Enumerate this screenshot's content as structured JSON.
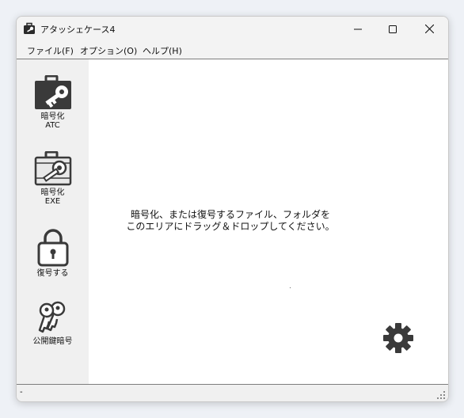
{
  "window": {
    "title": "アタッシェケース4",
    "minimize_icon": "minimize-icon",
    "maximize_icon": "maximize-icon",
    "close_icon": "close-icon"
  },
  "menu": {
    "items": [
      {
        "label": "ファイル(F)"
      },
      {
        "label": "オプション(O)"
      },
      {
        "label": "ヘルプ(H)"
      }
    ]
  },
  "sidebar": {
    "items": [
      {
        "line1": "暗号化",
        "line2": "ATC",
        "icon": "briefcase-key-icon"
      },
      {
        "line1": "暗号化",
        "line2": "EXE",
        "icon": "briefcase-key-outline-icon"
      },
      {
        "line1": "復号する",
        "line2": "",
        "icon": "padlock-icon"
      },
      {
        "line1": "公開鍵暗号",
        "line2": "",
        "icon": "keys-icon"
      }
    ]
  },
  "drop_area": {
    "line1": "暗号化、または復号するファイル、フォルダを",
    "line2": "このエリアにドラッグ＆ドロップしてください。",
    "settings_icon": "gear-icon"
  },
  "status": {
    "text": "-"
  },
  "colors": {
    "icon_dark": "#3a3a3a",
    "window_bg": "#f3f3f3",
    "sidebar_bg": "#f0f0f0",
    "content_bg": "#ffffff"
  }
}
